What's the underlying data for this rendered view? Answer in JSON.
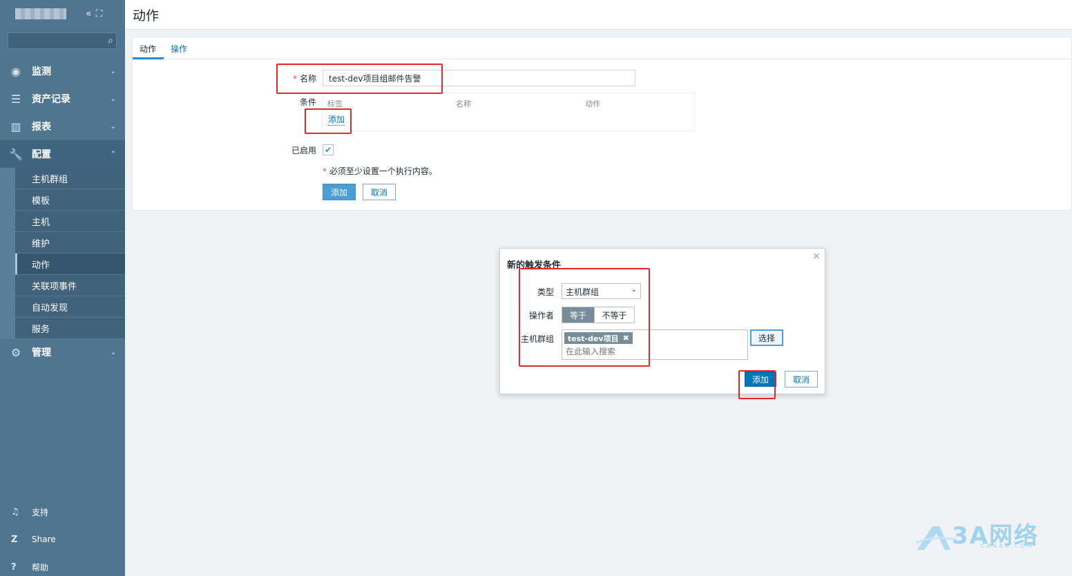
{
  "sidebar": {
    "collapse_icon": "«",
    "expand_icon": "⛶",
    "search_placeholder": "",
    "menu": [
      {
        "label": "监测",
        "icon": "eye-icon"
      },
      {
        "label": "资产记录",
        "icon": "list-icon"
      },
      {
        "label": "报表",
        "icon": "bar-chart-icon"
      },
      {
        "label": "配置",
        "icon": "wrench-icon"
      }
    ],
    "config_items": [
      "主机群组",
      "模板",
      "主机",
      "维护",
      "动作",
      "关联项事件",
      "自动发现",
      "服务"
    ],
    "admin_label": "管理",
    "footer": [
      {
        "label": "支持",
        "icon": "headset-icon"
      },
      {
        "label": "Share",
        "icon": "share-icon"
      },
      {
        "label": "帮助",
        "icon": "help-icon"
      }
    ]
  },
  "header": {
    "title": "动作"
  },
  "tabs": [
    "动作",
    "操作"
  ],
  "form": {
    "name_label": "名称",
    "name_value": "test-dev项目组邮件告警",
    "conditions_label": "条件",
    "cond_headers": [
      "标签",
      "名称",
      "动作"
    ],
    "cond_add": "添加",
    "enabled_label": "已启用",
    "note": "必须至少设置一个执行内容。",
    "add_button": "添加",
    "cancel_button": "取消"
  },
  "dialog": {
    "title": "新的触发条件",
    "type_label": "类型",
    "type_value": "主机群组",
    "operator_label": "操作者",
    "operator_options": [
      "等于",
      "不等于"
    ],
    "hostgroup_label": "主机群组",
    "chip_value": "test-dev项目",
    "search_placeholder": "在此输入搜索",
    "select_button": "选择",
    "add_button": "添加",
    "cancel_button": "取消"
  },
  "watermark": {
    "text": "3A网络",
    "sub": "CNAAA.COM"
  },
  "colors": {
    "sidebar": "#4f7590",
    "accent": "#0275b8",
    "highlight": "#e3262a"
  }
}
